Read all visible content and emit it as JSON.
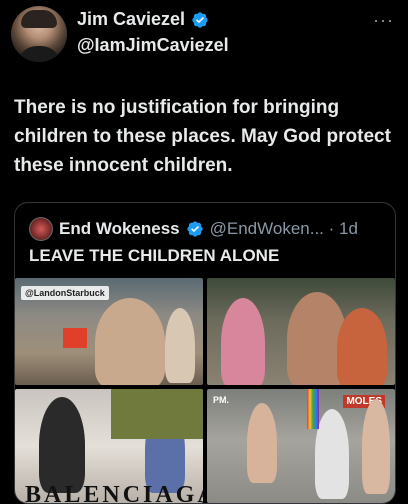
{
  "author": {
    "name": "Jim Caviezel",
    "handle": "@IamJimCaviezel",
    "verified": true
  },
  "more_label": "···",
  "tweet_text": "There is no justification for bringing children to these places. May God protect these innocent children.",
  "quote": {
    "name": "End Wokeness",
    "handle_time": "@EndWoken... · 1d",
    "verified": true,
    "text": "LEAVE THE CHILDREN ALONE",
    "media": [
      {
        "overlay": "@LandonStarbuck"
      },
      {
        "overlay": ""
      },
      {
        "overlay": "BALENCIAGA"
      },
      {
        "overlay": "PM.",
        "sign": "MOLES"
      }
    ]
  },
  "colors": {
    "background": "#000000",
    "text": "#e7e9ea",
    "muted": "#8b98a5",
    "verified": "#1d9bf0",
    "border": "#333639"
  }
}
